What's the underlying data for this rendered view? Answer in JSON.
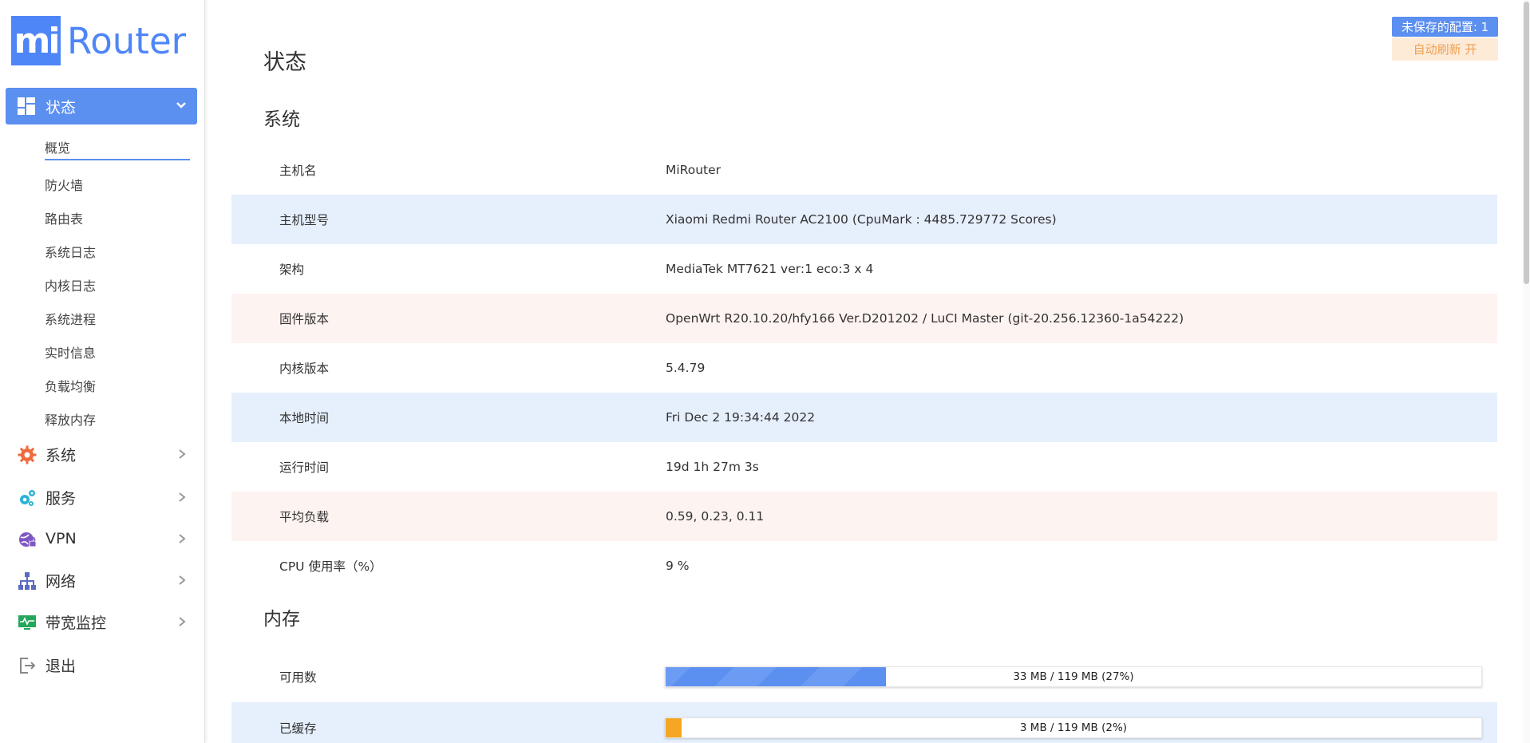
{
  "logo": {
    "mark": "mi",
    "text": "Router"
  },
  "sidebar": {
    "active": {
      "label": "状态",
      "icon": "dashboard-icon"
    },
    "submenu": [
      "概览",
      "防火墙",
      "路由表",
      "系统日志",
      "内核日志",
      "系统进程",
      "实时信息",
      "负载均衡",
      "释放内存"
    ],
    "items": [
      {
        "label": "系统",
        "icon": "gear-icon"
      },
      {
        "label": "服务",
        "icon": "services-gears-icon"
      },
      {
        "label": "VPN",
        "icon": "vpn-icon"
      },
      {
        "label": "网络",
        "icon": "network-icon"
      },
      {
        "label": "带宽监控",
        "icon": "monitor-icon"
      },
      {
        "label": "退出",
        "icon": "logout-icon"
      }
    ]
  },
  "badges": {
    "unsaved": "未保存的配置: 1",
    "auto_refresh": "自动刷新 开"
  },
  "page": {
    "title": "状态"
  },
  "system": {
    "title": "系统",
    "rows": [
      {
        "key": "主机名",
        "value": "MiRouter"
      },
      {
        "key": "主机型号",
        "value": "Xiaomi Redmi Router AC2100 (CpuMark : 4485.729772 Scores)"
      },
      {
        "key": "架构",
        "value": "MediaTek MT7621 ver:1 eco:3 x 4"
      },
      {
        "key": "固件版本",
        "value": "OpenWrt R20.10.20/hfy166 Ver.D201202 / LuCI Master (git-20.256.12360-1a54222)"
      },
      {
        "key": "内核版本",
        "value": "5.4.79"
      },
      {
        "key": "本地时间",
        "value": "Fri Dec 2 19:34:44 2022"
      },
      {
        "key": "运行时间",
        "value": "19d 1h 27m 3s"
      },
      {
        "key": "平均负载",
        "value": "0.59, 0.23, 0.11"
      },
      {
        "key": "CPU 使用率（%）",
        "value": "9 %"
      }
    ]
  },
  "memory": {
    "title": "内存",
    "rows": [
      {
        "key": "可用数",
        "bar_label": "33 MB / 119 MB (27%)",
        "percent": 27,
        "color": "#5b8ff0"
      },
      {
        "key": "已缓存",
        "bar_label": "3 MB / 119 MB (2%)",
        "percent": 2,
        "color": "#f5a623"
      }
    ]
  }
}
